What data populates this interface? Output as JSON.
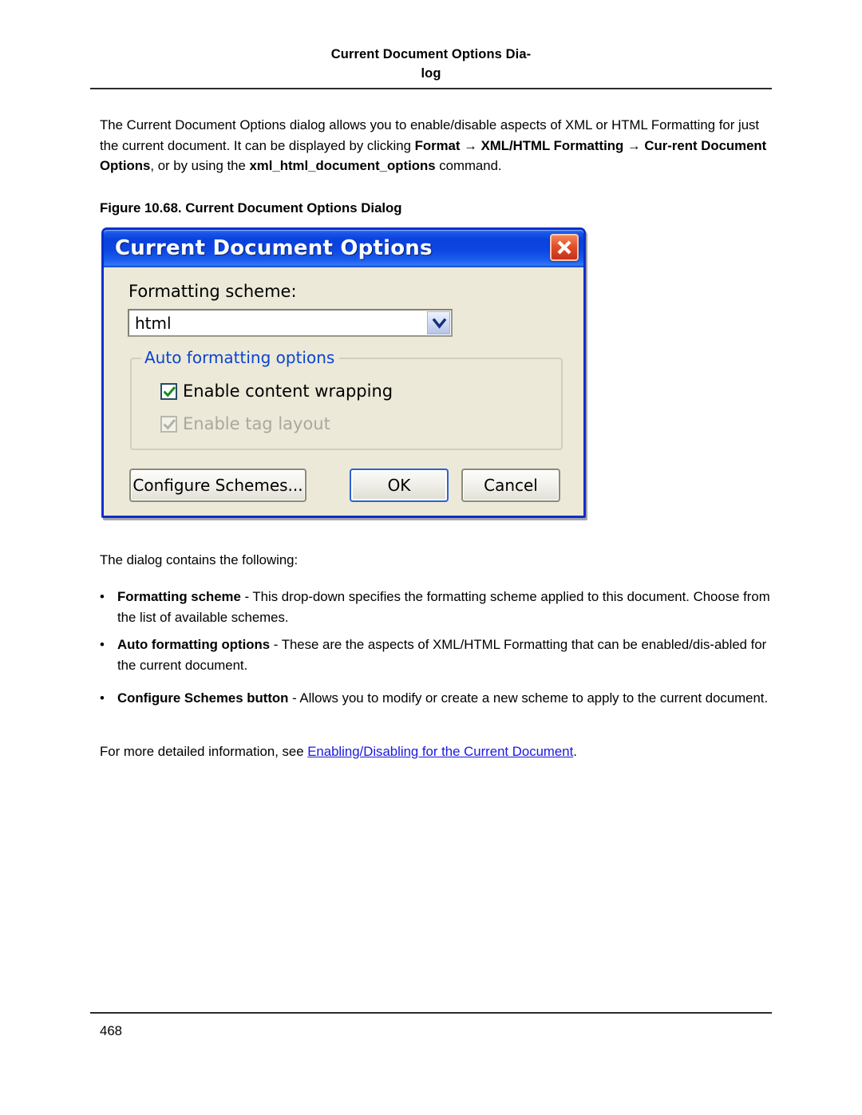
{
  "header": {
    "title_line1": "Current Document Options Dia-",
    "title_line2": "log"
  },
  "intro": {
    "t1": "The Current Document Options dialog allows you to enable/disable aspects of XML or HTML Formatting for just the current document. It can be displayed by clicking ",
    "b1": "Format",
    "arrow1": " → ",
    "b2": "XML/HTML Formatting",
    "arrow2": " → ",
    "b3": "Cur-rent Document Options",
    "t2": ", or by using the ",
    "b4": "xml_html_document_options",
    "t3": " command."
  },
  "figure": {
    "caption": "Figure 10.68.  Current Document Options Dialog"
  },
  "dialog": {
    "title": "Current Document Options",
    "close_icon": "close-icon",
    "formatting_scheme_label": "Formatting scheme:",
    "formatting_scheme_value": "html",
    "dropdown_icon": "chevron-down-icon",
    "group_legend": "Auto formatting options",
    "checkboxes": [
      {
        "label": "Enable content wrapping",
        "checked": true,
        "disabled": false
      },
      {
        "label": "Enable tag layout",
        "checked": true,
        "disabled": true
      }
    ],
    "buttons": {
      "configure": "Configure Schemes...",
      "ok": "OK",
      "cancel": "Cancel"
    }
  },
  "after_figure": {
    "lead": "The dialog contains the following:"
  },
  "bullets": [
    {
      "dot": "•",
      "term": "Formatting scheme",
      "desc": " - This drop-down specifies the formatting scheme applied to this document. Choose from the list of available schemes."
    },
    {
      "dot": "•",
      "term": "Auto formatting options",
      "desc": " - These are the aspects of XML/HTML Formatting that can be enabled/dis-abled for the current document."
    },
    {
      "dot": "•",
      "term": "Configure Schemes button",
      "desc": " - Allows you to modify or create a new scheme to apply to the current document."
    }
  ],
  "closing": {
    "prefix": "For more detailed information, see ",
    "link": "Enabling/Disabling for the Current Document",
    "suffix": "."
  },
  "footer": {
    "page_number": "468"
  },
  "colors": {
    "title_bar": "#0a41dd",
    "dialog_face": "#ece9d8",
    "legend_blue": "#0a44cf",
    "link_blue": "#1a18e0",
    "check_green": "#128c1b",
    "close_red": "#e2502a"
  }
}
